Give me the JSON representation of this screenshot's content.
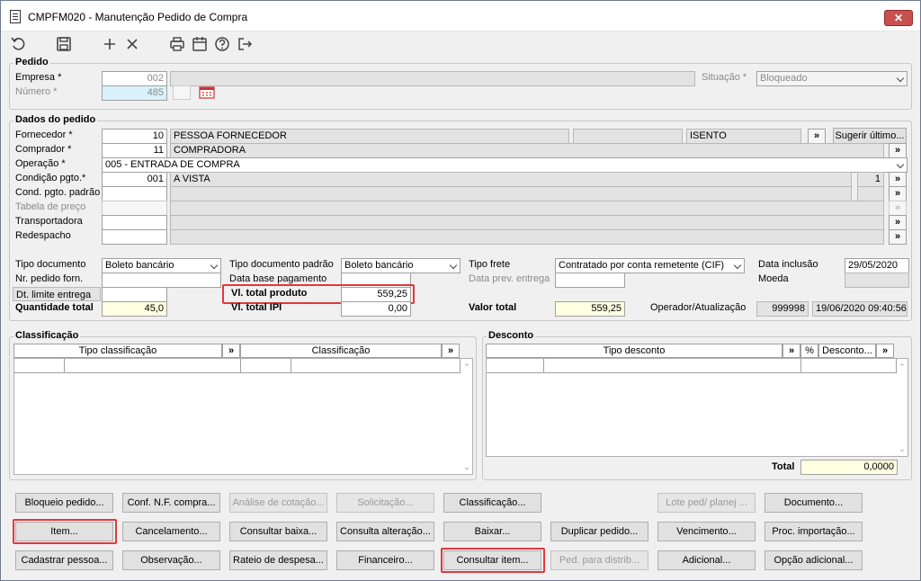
{
  "window": {
    "title": "CMPFM020 - Manutenção Pedido de Compra",
    "close": "✕"
  },
  "pedido": {
    "group_title": "Pedido",
    "empresa_label": "Empresa *",
    "empresa_value": "002",
    "numero_label": "Número *",
    "numero_value": "485",
    "situacao_label": "Situação *",
    "situacao_value": "Bloqueado"
  },
  "dados": {
    "group_title": "Dados do pedido",
    "fornecedor_label": "Fornecedor *",
    "fornecedor_code": "10",
    "fornecedor_name": "PESSOA FORNECEDOR",
    "fornecedor_tax": "ISENTO",
    "sugerir": "Sugerir último...",
    "comprador_label": "Comprador *",
    "comprador_code": "11",
    "comprador_name": "COMPRADORA",
    "operacao_label": "Operação *",
    "operacao_value": "005 - ENTRADA DE COMPRA",
    "condicao_label": "Condição pgto.*",
    "condicao_code": "001",
    "condicao_name": "A VISTA",
    "condicao_num": "1",
    "cond_padrao_label": "Cond. pgto. padrão",
    "tabela_label": "Tabela de preço",
    "transportadora_label": "Transportadora",
    "redespacho_label": "Redespacho",
    "tipo_doc_label": "Tipo documento",
    "tipo_doc_value": "Boleto bancário",
    "tipo_doc_padrao_label": "Tipo documento padrão",
    "tipo_doc_padrao_value": "Boleto bancário",
    "tipo_frete_label": "Tipo frete",
    "tipo_frete_value": "Contratado por conta remetente (CIF)",
    "data_inclusao_label": "Data inclusão",
    "data_inclusao_value": "29/05/2020",
    "nr_pedido_label": "Nr. pedido forn.",
    "data_base_label": "Data base pagamento",
    "data_prev_label": "Data prev. entrega",
    "moeda_label": "Moeda",
    "dt_limite_label": "Dt. limite entrega",
    "vl_total_produto_label": "Vl. total produto",
    "vl_total_produto_value": "559,25",
    "quantidade_label": "Quantidade total",
    "quantidade_value": "45,0",
    "vl_ipi_label": "Vl. total IPI",
    "vl_ipi_value": "0,00",
    "valor_total_label": "Valor total",
    "valor_total_value": "559,25",
    "operador_label": "Operador/Atualização",
    "operador_code": "999998",
    "operador_date": "19/06/2020 09:40:56"
  },
  "classificacao": {
    "group_title": "Classificação",
    "col1": "Tipo classificação",
    "col2": "Classificação"
  },
  "desconto": {
    "group_title": "Desconto",
    "col1": "Tipo desconto",
    "col2": "%",
    "col3": "Desconto...",
    "total_label": "Total",
    "total_value": "0,0000"
  },
  "arrow": "»",
  "buttons": {
    "row1": [
      "Bloqueio pedido...",
      "Conf. N.F. compra...",
      "Análise de cotação...",
      "Solicitação...",
      "Classificação...",
      "Lote ped/ planej ...",
      "Documento..."
    ],
    "row2": [
      "Item...",
      "Cancelamento...",
      "Consultar baixa...",
      "Consulta alteração...",
      "Baixar...",
      "Duplicar pedido...",
      "Vencimento...",
      "Proc. importação..."
    ],
    "row3": [
      "Cadastrar pessoa...",
      "Observação...",
      "Rateio de despesa...",
      "Financeiro...",
      "Consultar item...",
      "Ped. para distrib...",
      "Adicional...",
      "Opção adicional..."
    ]
  }
}
